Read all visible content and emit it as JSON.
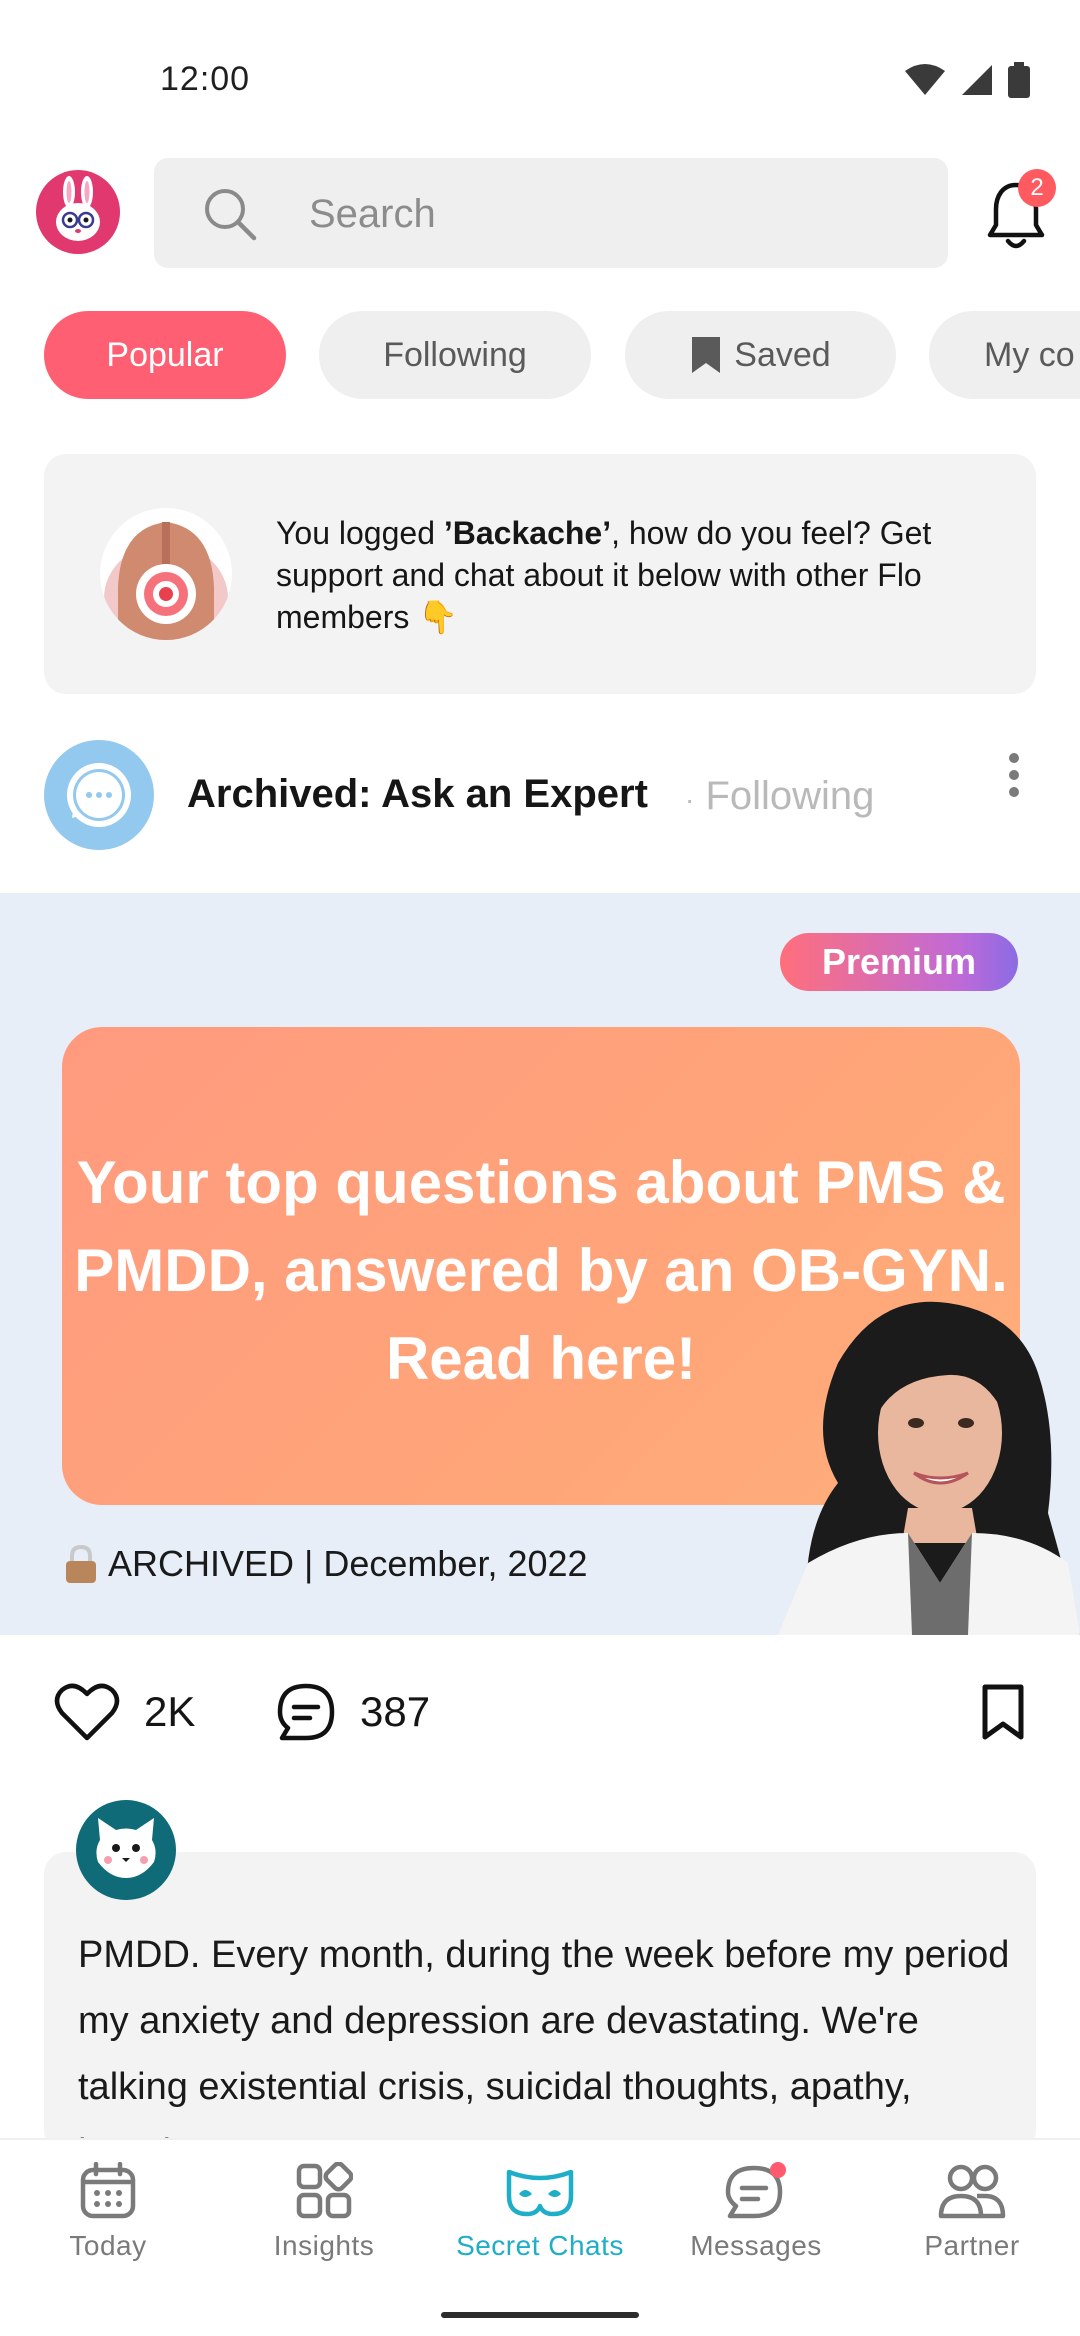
{
  "status_bar": {
    "time": "12:00"
  },
  "header": {
    "search_placeholder": "Search",
    "notification_count": "2"
  },
  "tabs": [
    {
      "label": "Popular",
      "active": true
    },
    {
      "label": "Following",
      "active": false
    },
    {
      "label": "Saved",
      "active": false,
      "icon": "bookmark-icon"
    },
    {
      "label": "My co",
      "active": false
    }
  ],
  "info_card": {
    "prefix": "You logged ",
    "symptom": "’Backache’",
    "suffix": ", how do you feel? Get support and chat about it below with other Flo members 👇"
  },
  "post": {
    "group_name": "Archived: Ask an Expert",
    "separator": "·",
    "follow_status": "Following",
    "banner": {
      "badge": "Premium",
      "headline": "Your top questions about PMS & PMDD, answered by an OB-GYN. Read here!",
      "archived_label": "ARCHIVED | December, 2022"
    },
    "likes": "2K",
    "comments": "387"
  },
  "comment_preview": {
    "text": "PMDD. Every month, during the week before my period my anxiety and depression are devastating. We're talking existential crisis, suicidal thoughts, apathy, hopelessness..."
  },
  "bottom_nav": [
    {
      "label": "Today",
      "icon": "calendar-icon",
      "active": false
    },
    {
      "label": "Insights",
      "icon": "grid-icon",
      "active": false
    },
    {
      "label": "Secret Chats",
      "icon": "mask-icon",
      "active": true
    },
    {
      "label": "Messages",
      "icon": "chat-bubble-icon",
      "active": false,
      "dot": true
    },
    {
      "label": "Partner",
      "icon": "people-icon",
      "active": false
    }
  ],
  "colors": {
    "accent_pink": "#ff5f73",
    "active_nav": "#1eaec8",
    "badge_red": "#ff5a5f"
  }
}
